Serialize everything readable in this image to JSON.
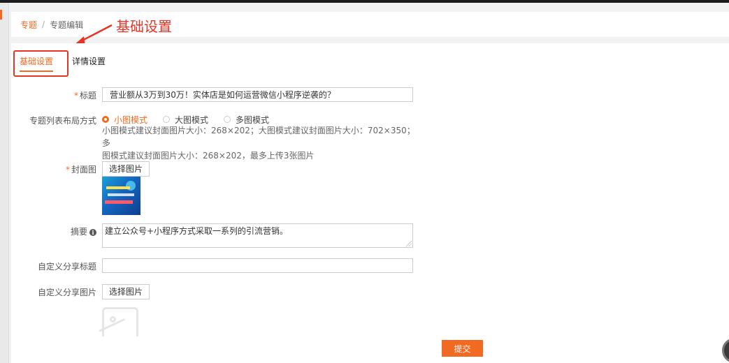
{
  "breadcrumb": {
    "parent": "专题",
    "separator": "/",
    "current": "专题编辑"
  },
  "annotation": {
    "label": "基础设置",
    "color": "#e53526"
  },
  "tabs": [
    {
      "label": "基础设置",
      "active": true
    },
    {
      "label": "详情设置",
      "active": false
    }
  ],
  "form": {
    "title": {
      "required_mark": "*",
      "label": "标题",
      "value": "营业额从3万到30万！实体店是如何运营微信小程序逆袭的？"
    },
    "layout": {
      "label": "专题列表布局方式",
      "options": [
        {
          "label": "小图模式",
          "selected": true
        },
        {
          "label": "大图模式",
          "selected": false
        },
        {
          "label": "多图模式",
          "selected": false
        }
      ],
      "hint_line1": "小图模式建议封面图片大小：268×202；大图模式建议封面图片大小：702×350；多",
      "hint_line2": "图模式建议封面图片大小：268×202，最多上传3张图片"
    },
    "cover": {
      "required_mark": "*",
      "label": "封面图",
      "button": "选择图片"
    },
    "summary": {
      "label": "摘要",
      "info_icon": "i",
      "value": "建立公众号+小程序方式采取一系列的引流营销。"
    },
    "share_title": {
      "label": "自定义分享标题",
      "value": ""
    },
    "share_image": {
      "label": "自定义分享图片",
      "button": "选择图片"
    },
    "submit_label": "提交"
  },
  "colors": {
    "accent": "#f26a21"
  }
}
